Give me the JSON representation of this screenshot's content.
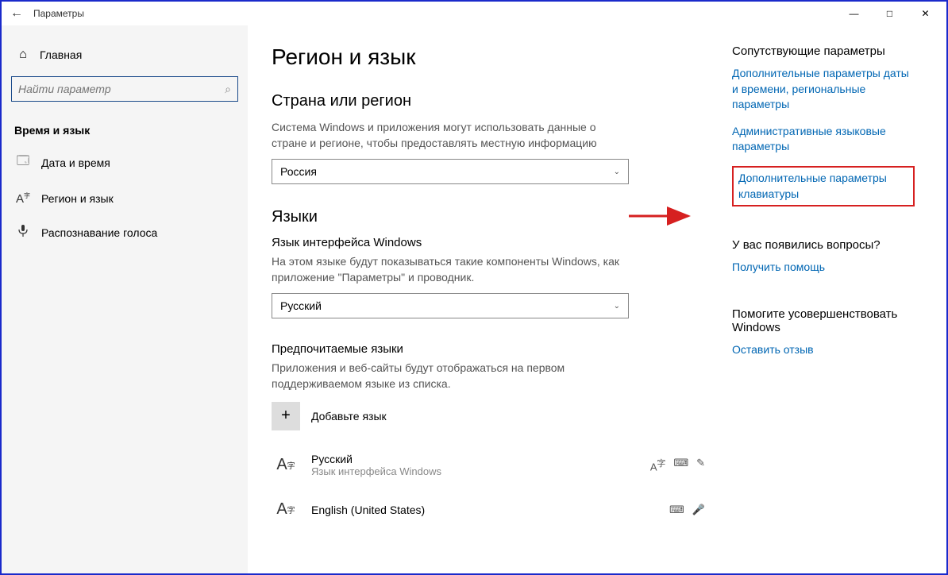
{
  "titlebar": {
    "title": "Параметры"
  },
  "sidebar": {
    "home": "Главная",
    "search_placeholder": "Найти параметр",
    "category": "Время и язык",
    "items": [
      {
        "label": "Дата и время"
      },
      {
        "label": "Регион и язык"
      },
      {
        "label": "Распознавание голоса"
      }
    ]
  },
  "main": {
    "title": "Регион и язык",
    "region_section": {
      "heading": "Страна или регион",
      "desc": "Система Windows и приложения могут использовать данные о стране и регионе, чтобы предоставлять местную информацию",
      "value": "Россия"
    },
    "lang_section": {
      "heading": "Языки",
      "display_label": "Язык интерфейса Windows",
      "display_desc": "На этом языке будут показываться такие компоненты Windows, как приложение \"Параметры\" и проводник.",
      "display_value": "Русский",
      "preferred_label": "Предпочитаемые языки",
      "preferred_desc": "Приложения и веб-сайты будут отображаться на первом поддерживаемом языке из списка.",
      "add_label": "Добавьте язык",
      "items": [
        {
          "name": "Русский",
          "sub": "Язык интерфейса Windows"
        },
        {
          "name": "English (United States)",
          "sub": ""
        }
      ]
    }
  },
  "right": {
    "related_heading": "Сопутствующие параметры",
    "links": [
      "Дополнительные параметры даты и времени, региональные параметры",
      "Административные языковые параметры",
      "Дополнительные параметры клавиатуры"
    ],
    "questions_heading": "У вас появились вопросы?",
    "help_link": "Получить помощь",
    "improve_heading": "Помогите усовершенствовать Windows",
    "feedback_link": "Оставить отзыв"
  }
}
